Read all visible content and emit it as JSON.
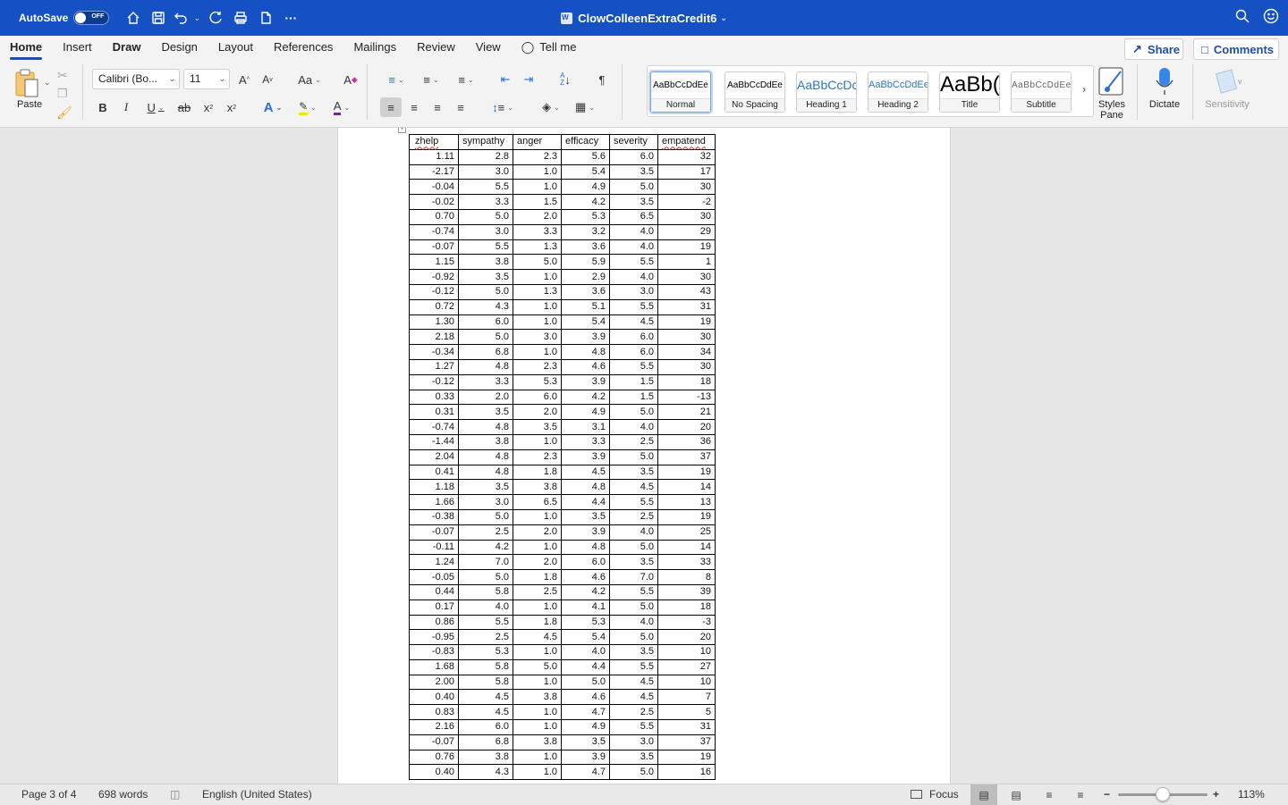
{
  "titlebar": {
    "autosave_label": "AutoSave",
    "autosave_state": "OFF",
    "doc_title": "ClowColleenExtraCredit6",
    "accent_color": "#1651c4"
  },
  "ribbon": {
    "tabs": [
      {
        "label": "Home",
        "active": true
      },
      {
        "label": "Insert"
      },
      {
        "label": "Draw"
      },
      {
        "label": "Design"
      },
      {
        "label": "Layout"
      },
      {
        "label": "References"
      },
      {
        "label": "Mailings"
      },
      {
        "label": "Review"
      },
      {
        "label": "View"
      },
      {
        "label": "Tell me"
      }
    ],
    "share_label": "Share",
    "comments_label": "Comments",
    "paste_label": "Paste",
    "font_name": "Calibri (Bo...",
    "font_size": "11",
    "change_case_label": "Aa",
    "styles": [
      {
        "sample": "AaBbCcDdEe",
        "name": "Normal",
        "selected": true
      },
      {
        "sample": "AaBbCcDdEe",
        "name": "No Spacing"
      },
      {
        "sample": "AaBbCcDc",
        "name": "Heading 1"
      },
      {
        "sample": "AaBbCcDdEe",
        "name": "Heading 2"
      },
      {
        "sample": "AaBb(",
        "name": "Title"
      },
      {
        "sample": "AaBbCcDdEe",
        "name": "Subtitle"
      }
    ],
    "styles_pane_label": "Styles Pane",
    "dictate_label": "Dictate",
    "sensitivity_label": "Sensitivity",
    "highlight_color": "#f5e600",
    "font_color": "#7a1fa2"
  },
  "table": {
    "headers": [
      "zhelp",
      "sympathy",
      "anger",
      "efficacy",
      "severity",
      "empatend"
    ],
    "rows": [
      [
        "1.11",
        "2.8",
        "2.3",
        "5.6",
        "6.0",
        "32"
      ],
      [
        "-2.17",
        "3.0",
        "1.0",
        "5.4",
        "3.5",
        "17"
      ],
      [
        "-0.04",
        "5.5",
        "1.0",
        "4.9",
        "5.0",
        "30"
      ],
      [
        "-0.02",
        "3.3",
        "1.5",
        "4.2",
        "3.5",
        "-2"
      ],
      [
        "0.70",
        "5.0",
        "2.0",
        "5.3",
        "6.5",
        "30"
      ],
      [
        "-0.74",
        "3.0",
        "3.3",
        "3.2",
        "4.0",
        "29"
      ],
      [
        "-0.07",
        "5.5",
        "1.3",
        "3.6",
        "4.0",
        "19"
      ],
      [
        "1.15",
        "3.8",
        "5.0",
        "5.9",
        "5.5",
        "1"
      ],
      [
        "-0.92",
        "3.5",
        "1.0",
        "2.9",
        "4.0",
        "30"
      ],
      [
        "-0.12",
        "5.0",
        "1.3",
        "3.6",
        "3.0",
        "43"
      ],
      [
        "0.72",
        "4.3",
        "1.0",
        "5.1",
        "5.5",
        "31"
      ],
      [
        "1.30",
        "6.0",
        "1.0",
        "5.4",
        "4.5",
        "19"
      ],
      [
        "2.18",
        "5.0",
        "3.0",
        "3.9",
        "6.0",
        "30"
      ],
      [
        "-0.34",
        "6.8",
        "1.0",
        "4.8",
        "6.0",
        "34"
      ],
      [
        "1.27",
        "4.8",
        "2.3",
        "4.6",
        "5.5",
        "30"
      ],
      [
        "-0.12",
        "3.3",
        "5.3",
        "3.9",
        "1.5",
        "18"
      ],
      [
        "0.33",
        "2.0",
        "6.0",
        "4.2",
        "1.5",
        "-13"
      ],
      [
        "0.31",
        "3.5",
        "2.0",
        "4.9",
        "5.0",
        "21"
      ],
      [
        "-0.74",
        "4.8",
        "3.5",
        "3.1",
        "4.0",
        "20"
      ],
      [
        "-1.44",
        "3.8",
        "1.0",
        "3.3",
        "2.5",
        "36"
      ],
      [
        "2.04",
        "4.8",
        "2.3",
        "3.9",
        "5.0",
        "37"
      ],
      [
        "0.41",
        "4.8",
        "1.8",
        "4.5",
        "3.5",
        "19"
      ],
      [
        "1.18",
        "3.5",
        "3.8",
        "4.8",
        "4.5",
        "14"
      ],
      [
        "1.66",
        "3.0",
        "6.5",
        "4.4",
        "5.5",
        "13"
      ],
      [
        "-0.38",
        "5.0",
        "1.0",
        "3.5",
        "2.5",
        "19"
      ],
      [
        "-0.07",
        "2.5",
        "2.0",
        "3.9",
        "4.0",
        "25"
      ],
      [
        "-0.11",
        "4.2",
        "1.0",
        "4.8",
        "5.0",
        "14"
      ],
      [
        "1.24",
        "7.0",
        "2.0",
        "6.0",
        "3.5",
        "33"
      ],
      [
        "-0.05",
        "5.0",
        "1.8",
        "4.6",
        "7.0",
        "8"
      ],
      [
        "0.44",
        "5.8",
        "2.5",
        "4.2",
        "5.5",
        "39"
      ],
      [
        "0.17",
        "4.0",
        "1.0",
        "4.1",
        "5.0",
        "18"
      ],
      [
        "0.86",
        "5.5",
        "1.8",
        "5.3",
        "4.0",
        "-3"
      ],
      [
        "-0.95",
        "2.5",
        "4.5",
        "5.4",
        "5.0",
        "20"
      ],
      [
        "-0.83",
        "5.3",
        "1.0",
        "4.0",
        "3.5",
        "10"
      ],
      [
        "1.68",
        "5.8",
        "5.0",
        "4.4",
        "5.5",
        "27"
      ],
      [
        "2.00",
        "5.8",
        "1.0",
        "5.0",
        "4.5",
        "10"
      ],
      [
        "0.40",
        "4.5",
        "3.8",
        "4.6",
        "4.5",
        "7"
      ],
      [
        "0.83",
        "4.5",
        "1.0",
        "4.7",
        "2.5",
        "5"
      ],
      [
        "2.16",
        "6.0",
        "1.0",
        "4.9",
        "5.5",
        "31"
      ],
      [
        "-0.07",
        "6.8",
        "3.8",
        "3.5",
        "3.0",
        "37"
      ],
      [
        "0.76",
        "3.8",
        "1.0",
        "3.9",
        "3.5",
        "19"
      ],
      [
        "0.40",
        "4.3",
        "1.0",
        "4.7",
        "5.0",
        "16"
      ]
    ]
  },
  "statusbar": {
    "page": "Page 3 of 4",
    "words": "698 words",
    "language": "English (United States)",
    "focus_label": "Focus",
    "zoom_level": "113%",
    "zoom_slider_fraction": 0.5
  }
}
